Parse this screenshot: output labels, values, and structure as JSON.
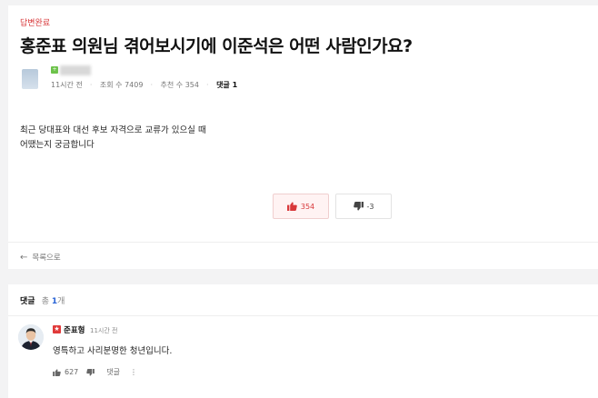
{
  "post": {
    "status_badge": "답변완료",
    "title": "홍준표 의원님 겪어보시기에 이준석은 어떤 사람인가요?",
    "level_badge": "+",
    "meta": {
      "time": "11시간 전",
      "views": "조회 수 7409",
      "recommends": "추천 수 354",
      "comments_label": "댓글 1"
    },
    "body_lines": [
      "최근 당대표와 대선 후보 자격으로 교류가 있으실 때",
      "어땠는지 궁금합니다"
    ],
    "upvote_count": "354",
    "downvote_count": "-3",
    "back_label": "목록으로"
  },
  "comments": {
    "header": "댓글",
    "total_prefix": "총",
    "total_count": "1",
    "total_suffix": "개",
    "item": {
      "badge": "★",
      "author": "준표형",
      "time": "11시간 전",
      "text": "영특하고 사리분명한 청년입니다.",
      "like_count": "627",
      "reply_label": "댓글",
      "more_label": "⋮"
    }
  },
  "colors": {
    "accent_red": "#d8383a",
    "link_blue": "#2a64d6",
    "level_green": "#6cc24a"
  }
}
